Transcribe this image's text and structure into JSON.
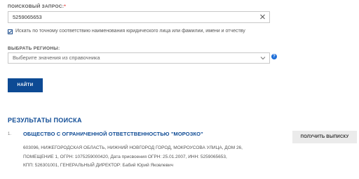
{
  "search": {
    "label": "ПОИСКОВЫЙ ЗАПРОС:",
    "required_mark": "*",
    "value": "5259065653",
    "exact_match_label": "Искать по точному соответствию наименования юридического лица или фамилии, имени и отчеству",
    "exact_match_checked": true
  },
  "regions": {
    "label": "ВЫБРАТЬ РЕГИОНЫ:",
    "placeholder": "Выберите значения из справочника",
    "help_symbol": "?"
  },
  "search_button": {
    "label": "НАЙТИ"
  },
  "results": {
    "title": "РЕЗУЛЬТАТЫ ПОИСКА",
    "items": [
      {
        "number": "1.",
        "name": "ОБЩЕСТВО С ОГРАНИЧЕННОЙ ОТВЕТСТВЕННОСТЬЮ \"МОРОЗКО\"",
        "details_lines": [
          "603096, НИЖЕГОРОДСКАЯ ОБЛАСТЬ, НИЖНИЙ НОВГОРОД ГОРОД, МОКРОУСОВА УЛИЦА, ДОМ 26,",
          "ПОМЕЩЕНИЕ 1, ОГРН: 1075259000420, Дата присвоения ОГРН: 25.01.2007, ИНН: 5259065653,",
          "КПП: 526301001, ГЕНЕРАЛЬНЫЙ ДИРЕКТОР: Бабий Юрий Яковлевич"
        ],
        "extract_button": "ПОЛУЧИТЬ ВЫПИСКУ"
      }
    ]
  },
  "colors": {
    "brand": "#0d4a94",
    "required": "#e53935",
    "help": "#1e6fd9"
  }
}
